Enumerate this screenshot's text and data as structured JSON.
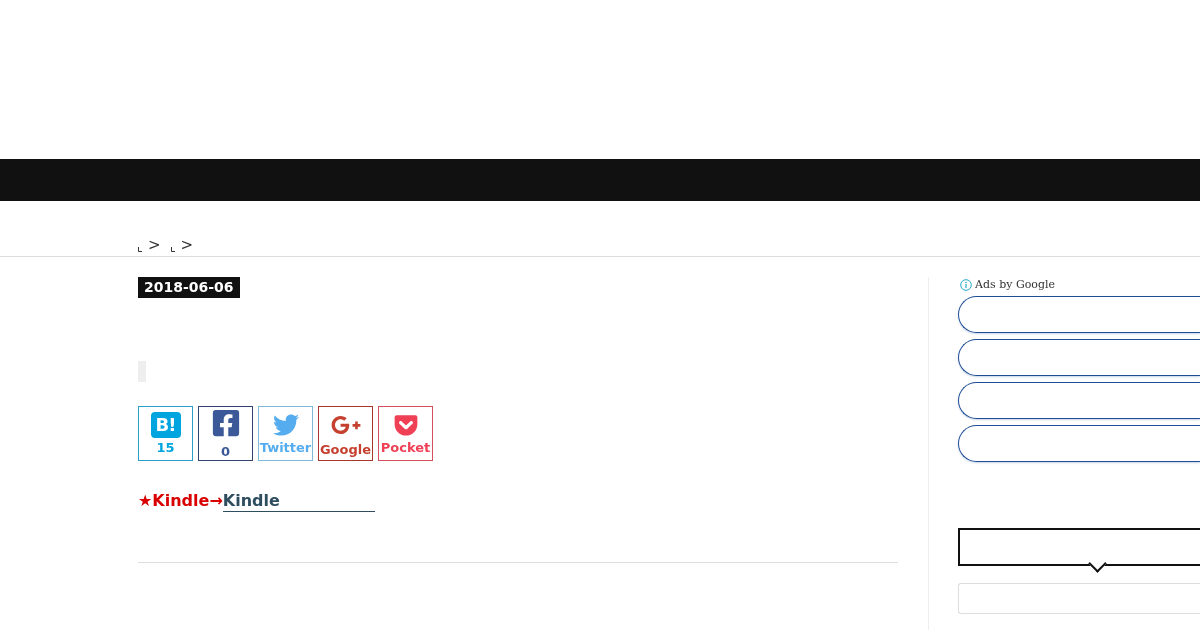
{
  "breadcrumb": [
    {
      "separator": ">"
    },
    {
      "separator": ">"
    }
  ],
  "post": {
    "date": "2018-06-06",
    "share_buttons": [
      {
        "kind": "hatena",
        "logo_text": "B!",
        "label": "15"
      },
      {
        "kind": "facebook",
        "label": "0"
      },
      {
        "kind": "twitter",
        "label": "Twitter"
      },
      {
        "kind": "google",
        "label": "Google"
      },
      {
        "kind": "pocket",
        "label": "Pocket"
      }
    ],
    "promo": {
      "text": "★Kindle→",
      "link": "Kindle"
    }
  },
  "sidebar": {
    "ads_label": "Ads by Google",
    "ad_buttons": [
      {
        "kind": "ad-link"
      },
      {
        "kind": "ad-link"
      },
      {
        "kind": "ad-link"
      },
      {
        "kind": "ad-link"
      }
    ]
  }
}
